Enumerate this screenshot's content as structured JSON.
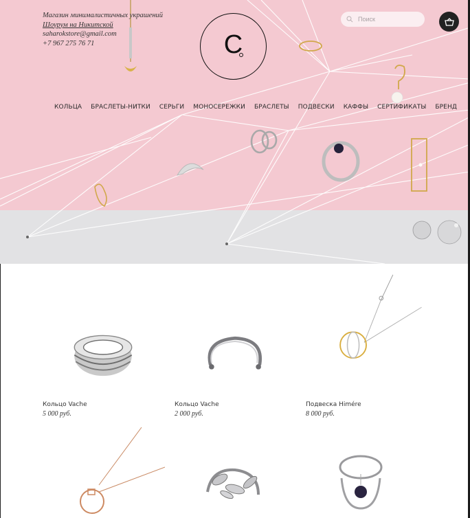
{
  "store": {
    "tagline": "Магазин минималистичных украшений",
    "showroom": "Шоурум на Никитской",
    "email": "saharokstore@gmail.com",
    "phone": "+7 967 275 76 71",
    "logo_letter": "C"
  },
  "search": {
    "placeholder": "Поиск"
  },
  "nav": {
    "items": [
      {
        "label": "КОЛЬЦА"
      },
      {
        "label": "БРАСЛЕТЫ-НИТКИ"
      },
      {
        "label": "СЕРЬГИ"
      },
      {
        "label": "МОНОСЕРЕЖКИ"
      },
      {
        "label": "БРАСЛЕТЫ"
      },
      {
        "label": "ПОДВЕСКИ"
      },
      {
        "label": "КАФФЫ"
      },
      {
        "label": "СЕРТИФИКАТЫ"
      },
      {
        "label": "БРЕНД"
      }
    ]
  },
  "products": [
    {
      "name": "Кольцо Vache",
      "price": "5 000 руб.",
      "icon": "silver-band-ring"
    },
    {
      "name": "Кольцо Vache",
      "price": "2 000 руб.",
      "icon": "open-cuff-ring"
    },
    {
      "name": "Подвеска Himére",
      "price": "8 000 руб.",
      "icon": "gold-orbit-pendant"
    },
    {
      "icon": "rose-gold-circle-pendant"
    },
    {
      "icon": "silver-leaf-ring"
    },
    {
      "icon": "silver-pearl-ring"
    }
  ],
  "colors": {
    "hero_pink": "#f4c9d1",
    "hero_grey": "#e2e2e4",
    "cart_bg": "#222222"
  }
}
